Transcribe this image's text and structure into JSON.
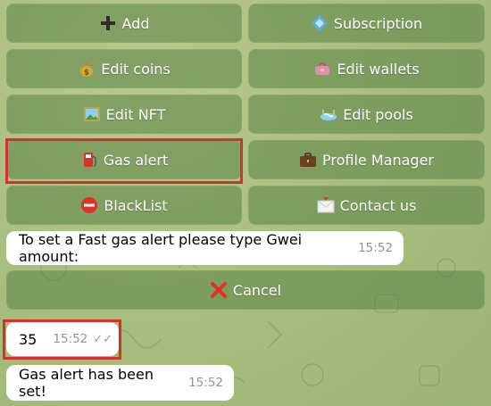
{
  "keyboard": {
    "add": "Add",
    "subscription": "Subscription",
    "edit_coins": "Edit coins",
    "edit_wallets": "Edit wallets",
    "edit_nft": "Edit NFT",
    "edit_pools": "Edit pools",
    "gas_alert": "Gas alert",
    "profile_manager": "Profile Manager",
    "blacklist": "BlackList",
    "contact_us": "Contact us"
  },
  "messages": {
    "prompt": {
      "text": "To set a Fast gas alert please type Gwei amount:",
      "time": "15:52"
    },
    "cancel": "Cancel",
    "user_reply": {
      "text": "35",
      "time": "15:52"
    },
    "confirmation": {
      "text": "Gas alert has been set!",
      "time": "15:52"
    }
  },
  "icons": {
    "add": "plus-icon",
    "subscription": "diamond-icon",
    "edit_coins": "money-bag-icon",
    "edit_wallets": "purse-icon",
    "edit_nft": "picture-icon",
    "edit_pools": "pool-icon",
    "gas_alert": "fuel-pump-icon",
    "profile_manager": "briefcase-icon",
    "blacklist": "stop-icon",
    "contact_us": "envelope-icon",
    "cancel": "cross-icon",
    "read": "double-check-icon"
  },
  "colors": {
    "highlight": "#d62f2f",
    "read_ticks": "#5fb36a",
    "cancel_x": "#e0302a"
  }
}
